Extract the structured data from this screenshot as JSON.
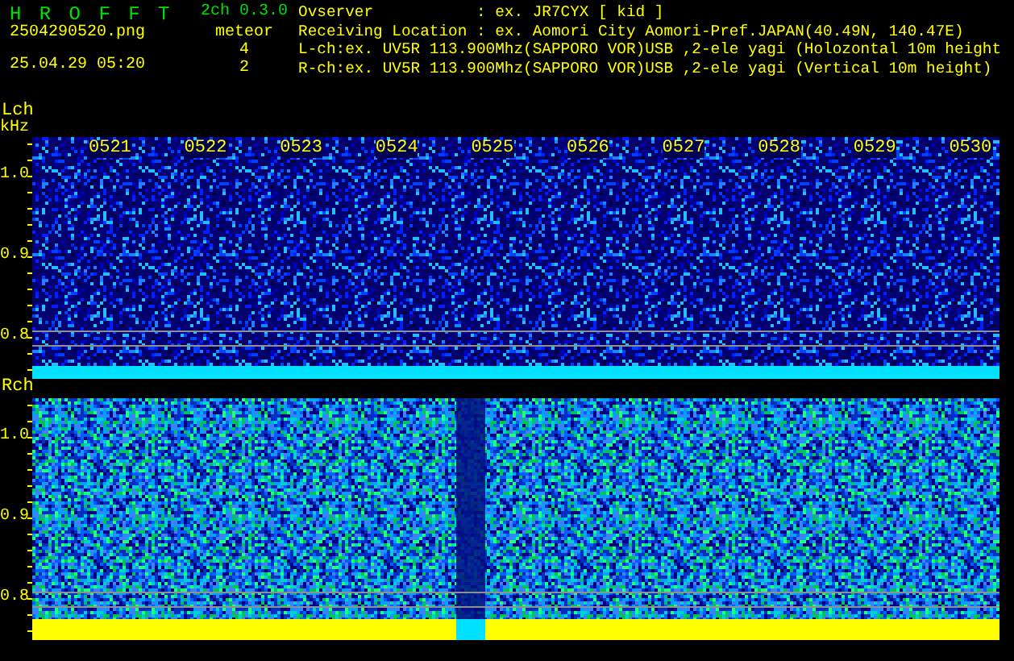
{
  "header": {
    "title": "H R O F F T",
    "version": "2ch 0.3.0",
    "filename": "2504290520.png",
    "datetime": "25.04.29 05:20",
    "meteor_label": "meteor",
    "info": [
      {
        "label": "Ovserver",
        "value": ": ex. JR7CYX [ kid ]"
      },
      {
        "label": "Receiving Location",
        "value": ": ex. Aomori City Aomori-Pref.JAPAN(40.49N, 140.47E)"
      },
      {
        "label": "L-ch:",
        "value": "ex. UV5R 113.900Mhz(SAPPORO VOR)USB ,2-ele yagi (Holozontal 10m height"
      },
      {
        "label": "R-ch:",
        "value": "ex. UV5R 113.900Mhz(SAPPORO VOR)USB ,2-ele yagi (Vertical 10m height)"
      }
    ]
  },
  "channels": [
    {
      "name": "Lch",
      "unit": "kHz",
      "meteor_count": "4",
      "kind": "faint",
      "ticks": [
        "1.0",
        "0.9",
        "0.8"
      ],
      "time_labels": [
        "0521",
        "0522",
        "0523",
        "0524",
        "0525",
        "0526",
        "0527",
        "0528",
        "0529",
        "0530"
      ]
    },
    {
      "name": "Rch",
      "meteor_count": "2",
      "kind": "noisy",
      "ticks": [
        "1.0",
        "0.9",
        "0.8"
      ]
    }
  ]
}
